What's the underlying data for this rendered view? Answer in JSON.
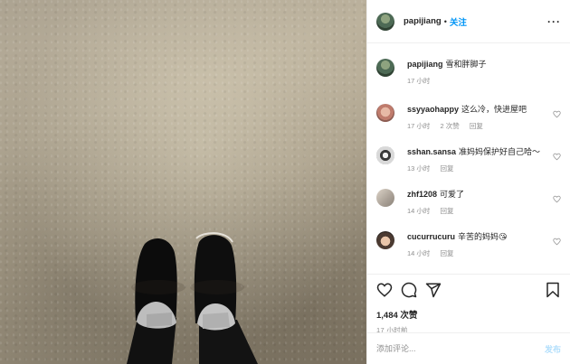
{
  "post": {
    "image_alt": "Feet in black shoes on snowy ground"
  },
  "header": {
    "username": "papijiang",
    "separator": "•",
    "follow_label": "关注",
    "more_icon": "more-icon",
    "more_label": "···"
  },
  "caption": {
    "username": "papijiang",
    "text": "雪和胖脚子",
    "time": "17 小时"
  },
  "comments": [
    {
      "username": "ssyyaohappy",
      "text": "这么冷，快进屋吧",
      "time": "17 小时",
      "likes": "2 次赞",
      "reply": "回复"
    },
    {
      "username": "sshan.sansa",
      "text": "准妈妈保护好自己哈～",
      "time": "13 小时",
      "likes": "",
      "reply": "回复"
    },
    {
      "username": "zhf1208",
      "text": "可爱了",
      "time": "14 小时",
      "likes": "",
      "reply": "回复"
    },
    {
      "username": "cucurrucuru",
      "text": "辛苦的妈妈😘",
      "time": "14 小时",
      "likes": "",
      "reply": "回复"
    }
  ],
  "actions": {
    "like_icon": "heart-icon",
    "comment_icon": "comment-icon",
    "share_icon": "share-icon",
    "save_icon": "bookmark-icon",
    "likes_text": "1,484 次赞",
    "time": "17 小时前"
  },
  "add_comment": {
    "placeholder": "添加评论...",
    "post_label": "发布"
  },
  "colors": {
    "link": "#0095f6",
    "muted": "#8e8e8e",
    "post_disabled": "#b2dffc"
  }
}
